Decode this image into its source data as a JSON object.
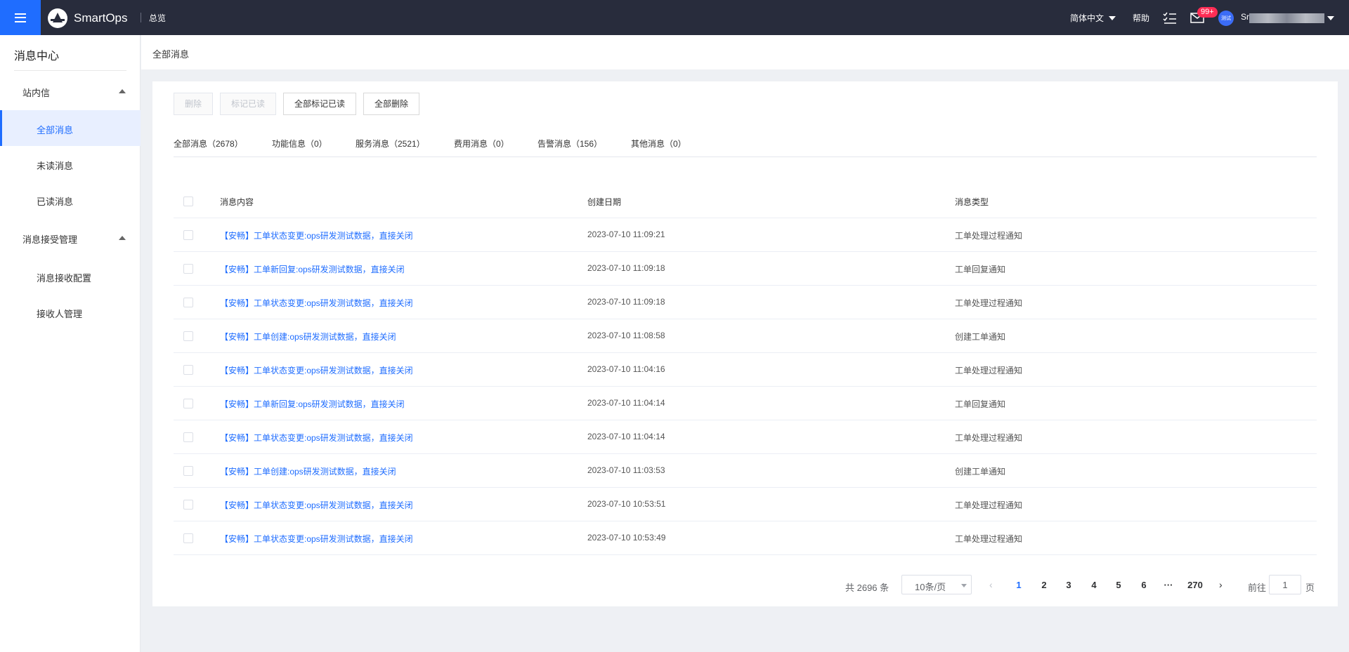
{
  "topbar": {
    "brand": "SmartOps",
    "overview": "总览",
    "language": "简体中文",
    "help": "帮助",
    "mail_badge": "99+",
    "avatar_text": "测试",
    "user_name_prefix": "Sr",
    "brand_color": "#1f6dff",
    "icons": [
      "menu-icon",
      "logo-icon",
      "todo-list-icon",
      "mail-icon",
      "chevron-down-icon"
    ]
  },
  "sidebar": {
    "title": "消息中心",
    "groups": [
      {
        "label": "站内信",
        "items": [
          "全部消息",
          "未读消息",
          "已读消息"
        ]
      },
      {
        "label": "消息接受管理",
        "items": [
          "消息接收配置",
          "接收人管理"
        ]
      }
    ],
    "active_item": "全部消息"
  },
  "page": {
    "header": "全部消息"
  },
  "toolbar": {
    "delete": "删除",
    "mark_read": "标记已读",
    "mark_all_read": "全部标记已读",
    "delete_all": "全部删除"
  },
  "tabs": [
    "全部消息（2678）",
    "功能信息（0）",
    "服务消息（2521）",
    "费用消息（0）",
    "告警消息（156）",
    "其他消息（0）"
  ],
  "table": {
    "headers": {
      "content": "消息内容",
      "date": "创建日期",
      "type": "消息类型"
    },
    "rows": [
      {
        "content": "【安畅】工单状态变更:ops研发测试数据，直接关闭",
        "date": "2023-07-10 11:09:21",
        "type": "工单处理过程通知"
      },
      {
        "content": "【安畅】工单新回复:ops研发测试数据，直接关闭",
        "date": "2023-07-10 11:09:18",
        "type": "工单回复通知"
      },
      {
        "content": "【安畅】工单状态变更:ops研发测试数据，直接关闭",
        "date": "2023-07-10 11:09:18",
        "type": "工单处理过程通知"
      },
      {
        "content": "【安畅】工单创建:ops研发测试数据，直接关闭",
        "date": "2023-07-10 11:08:58",
        "type": "创建工单通知"
      },
      {
        "content": "【安畅】工单状态变更:ops研发测试数据，直接关闭",
        "date": "2023-07-10 11:04:16",
        "type": "工单处理过程通知"
      },
      {
        "content": "【安畅】工单新回复:ops研发测试数据，直接关闭",
        "date": "2023-07-10 11:04:14",
        "type": "工单回复通知"
      },
      {
        "content": "【安畅】工单状态变更:ops研发测试数据，直接关闭",
        "date": "2023-07-10 11:04:14",
        "type": "工单处理过程通知"
      },
      {
        "content": "【安畅】工单创建:ops研发测试数据，直接关闭",
        "date": "2023-07-10 11:03:53",
        "type": "创建工单通知"
      },
      {
        "content": "【安畅】工单状态变更:ops研发测试数据，直接关闭",
        "date": "2023-07-10 10:53:51",
        "type": "工单处理过程通知"
      },
      {
        "content": "【安畅】工单状态变更:ops研发测试数据，直接关闭",
        "date": "2023-07-10 10:53:49",
        "type": "工单处理过程通知"
      }
    ]
  },
  "pagination": {
    "total": "共 2696 条",
    "page_size": "10条/页",
    "pages": [
      "1",
      "2",
      "3",
      "4",
      "5",
      "6"
    ],
    "ellipsis": "···",
    "last_page": "270",
    "current_page": "1",
    "goto_label": "前往",
    "goto_value": "1",
    "goto_suffix": "页",
    "prev": "‹",
    "next": "›"
  }
}
